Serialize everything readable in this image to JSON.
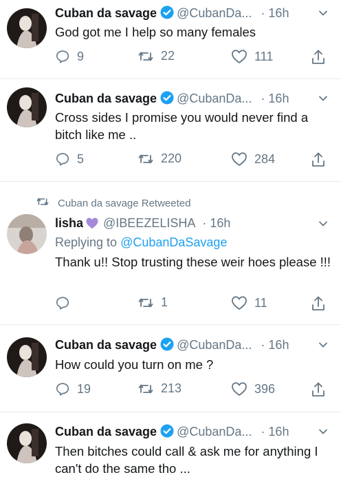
{
  "tweets": [
    {
      "name": "Cuban da savage",
      "handle": "@CubanDa...",
      "time": "16h",
      "text": "God got me I help so many females",
      "replies": "9",
      "retweets": "22",
      "likes": "111"
    },
    {
      "name": "Cuban da savage",
      "handle": "@CubanDa...",
      "time": "16h",
      "text": "Cross sides I promise you would never find a bitch like me ..",
      "replies": "5",
      "retweets": "220",
      "likes": "284"
    },
    {
      "retweeted_by": "Cuban da savage Retweeted",
      "name": "lisha",
      "handle": "@IBEEZELISHA",
      "time": "16h",
      "replying_prefix": "Replying to",
      "replying_to": "@CubanDaSavage",
      "text": "Thank u!! Stop trusting these weir hoes please !!!",
      "replies": "",
      "retweets": "1",
      "likes": "11"
    },
    {
      "name": "Cuban da savage",
      "handle": "@CubanDa...",
      "time": "16h",
      "text": "How could you turn on me ?",
      "replies": "19",
      "retweets": "213",
      "likes": "396"
    },
    {
      "name": "Cuban da savage",
      "handle": "@CubanDa...",
      "time": "16h",
      "text": "Then bitches could call & ask me for anything I can't do the same tho ..."
    }
  ],
  "dot": "·",
  "colors": {
    "name_text": "#14171a",
    "secondary_text": "#657786",
    "accent_blue": "#1da1f2",
    "divider": "#e6ecf0",
    "verified_badge": "#1da1f2",
    "purple_heart": "#a48ad8"
  },
  "icons": [
    "verified-badge-icon",
    "chevron-down-icon",
    "reply-icon",
    "retweet-icon",
    "like-icon",
    "share-icon",
    "purple-heart-emoji"
  ]
}
